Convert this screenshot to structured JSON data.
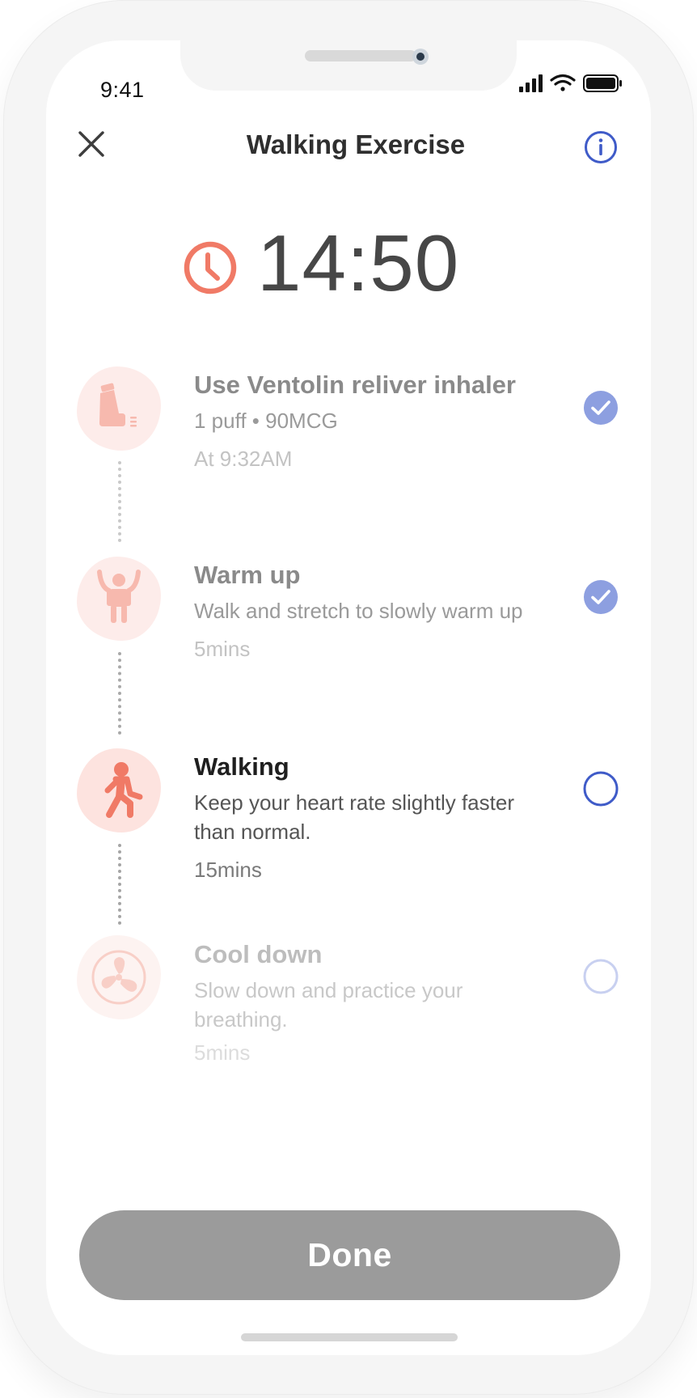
{
  "status_bar": {
    "time": "9:41"
  },
  "header": {
    "title": "Walking Exercise"
  },
  "timer": {
    "value": "14:50"
  },
  "steps": [
    {
      "icon": "inhaler-icon",
      "title": "Use Ventolin reliver inhaler",
      "description": "1 puff • 90MCG",
      "meta": "At 9:32AM",
      "completed": true
    },
    {
      "icon": "warm-up-person-icon",
      "title": "Warm up",
      "description": "Walk and stretch to slowly warm up",
      "meta": "5mins",
      "completed": true
    },
    {
      "icon": "walking-person-icon",
      "title": "Walking",
      "description": "Keep your heart rate slightly faster than normal.",
      "meta": "15mins",
      "completed": false,
      "current": true
    },
    {
      "icon": "fan-icon",
      "title": "Cool down",
      "description": "Slow down and practice your breathing.",
      "meta": "5mins",
      "completed": false
    }
  ],
  "footer": {
    "done_label": "Done"
  },
  "colors": {
    "accent": "#3f5bc8",
    "check_done": "#8d9fe0",
    "coral": "#f07a66",
    "button_disabled": "#9b9b9b"
  }
}
